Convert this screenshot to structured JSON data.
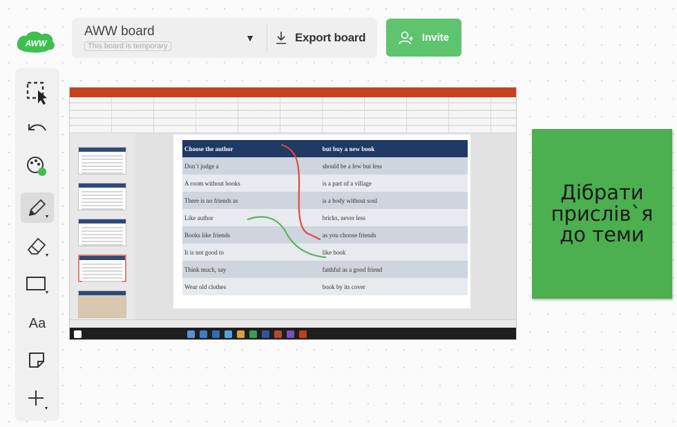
{
  "app": {
    "logo_text": "AWW",
    "accent_color": "#5ec46f"
  },
  "header": {
    "board_title": "AWW board",
    "board_subtitle": "This board is temporary",
    "export_label": "Export board",
    "invite_label": "Invite"
  },
  "toolbar": {
    "tools": [
      {
        "name": "select-tool",
        "icon": "selection-cursor-icon"
      },
      {
        "name": "undo-tool",
        "icon": "undo-arrow-icon"
      },
      {
        "name": "color-tool",
        "icon": "palette-icon"
      },
      {
        "name": "pen-tool",
        "icon": "pencil-icon",
        "active": true
      },
      {
        "name": "eraser-tool",
        "icon": "eraser-icon"
      },
      {
        "name": "shape-tool",
        "icon": "rectangle-icon"
      },
      {
        "name": "text-tool",
        "icon": "text-icon",
        "label": "Aa"
      },
      {
        "name": "sticky-note-tool",
        "icon": "sticky-note-icon"
      },
      {
        "name": "add-tool",
        "icon": "plus-icon"
      }
    ]
  },
  "screenshot": {
    "table": {
      "header": [
        "Choose the author",
        "but buy a new book"
      ],
      "rows": [
        [
          "Don`t judge a",
          "should be a few but less"
        ],
        [
          "A room without books",
          "is a part of a village"
        ],
        [
          "There is no friends as",
          "is a body without soul"
        ],
        [
          "Like author",
          "bricks, never less"
        ],
        [
          "Books like friends",
          "as you choose friends"
        ],
        [
          "It is not good to",
          "like book"
        ],
        [
          "Think much, say",
          "faithful as a good friend"
        ],
        [
          "Wear old clothes",
          "book by its cover"
        ]
      ]
    },
    "ink_colors": {
      "red": "#e8453c",
      "green": "#5ab45a"
    }
  },
  "sticky_note": {
    "text": "Дібрати\nприслів`я\nдо теми",
    "color": "#4caf50"
  }
}
